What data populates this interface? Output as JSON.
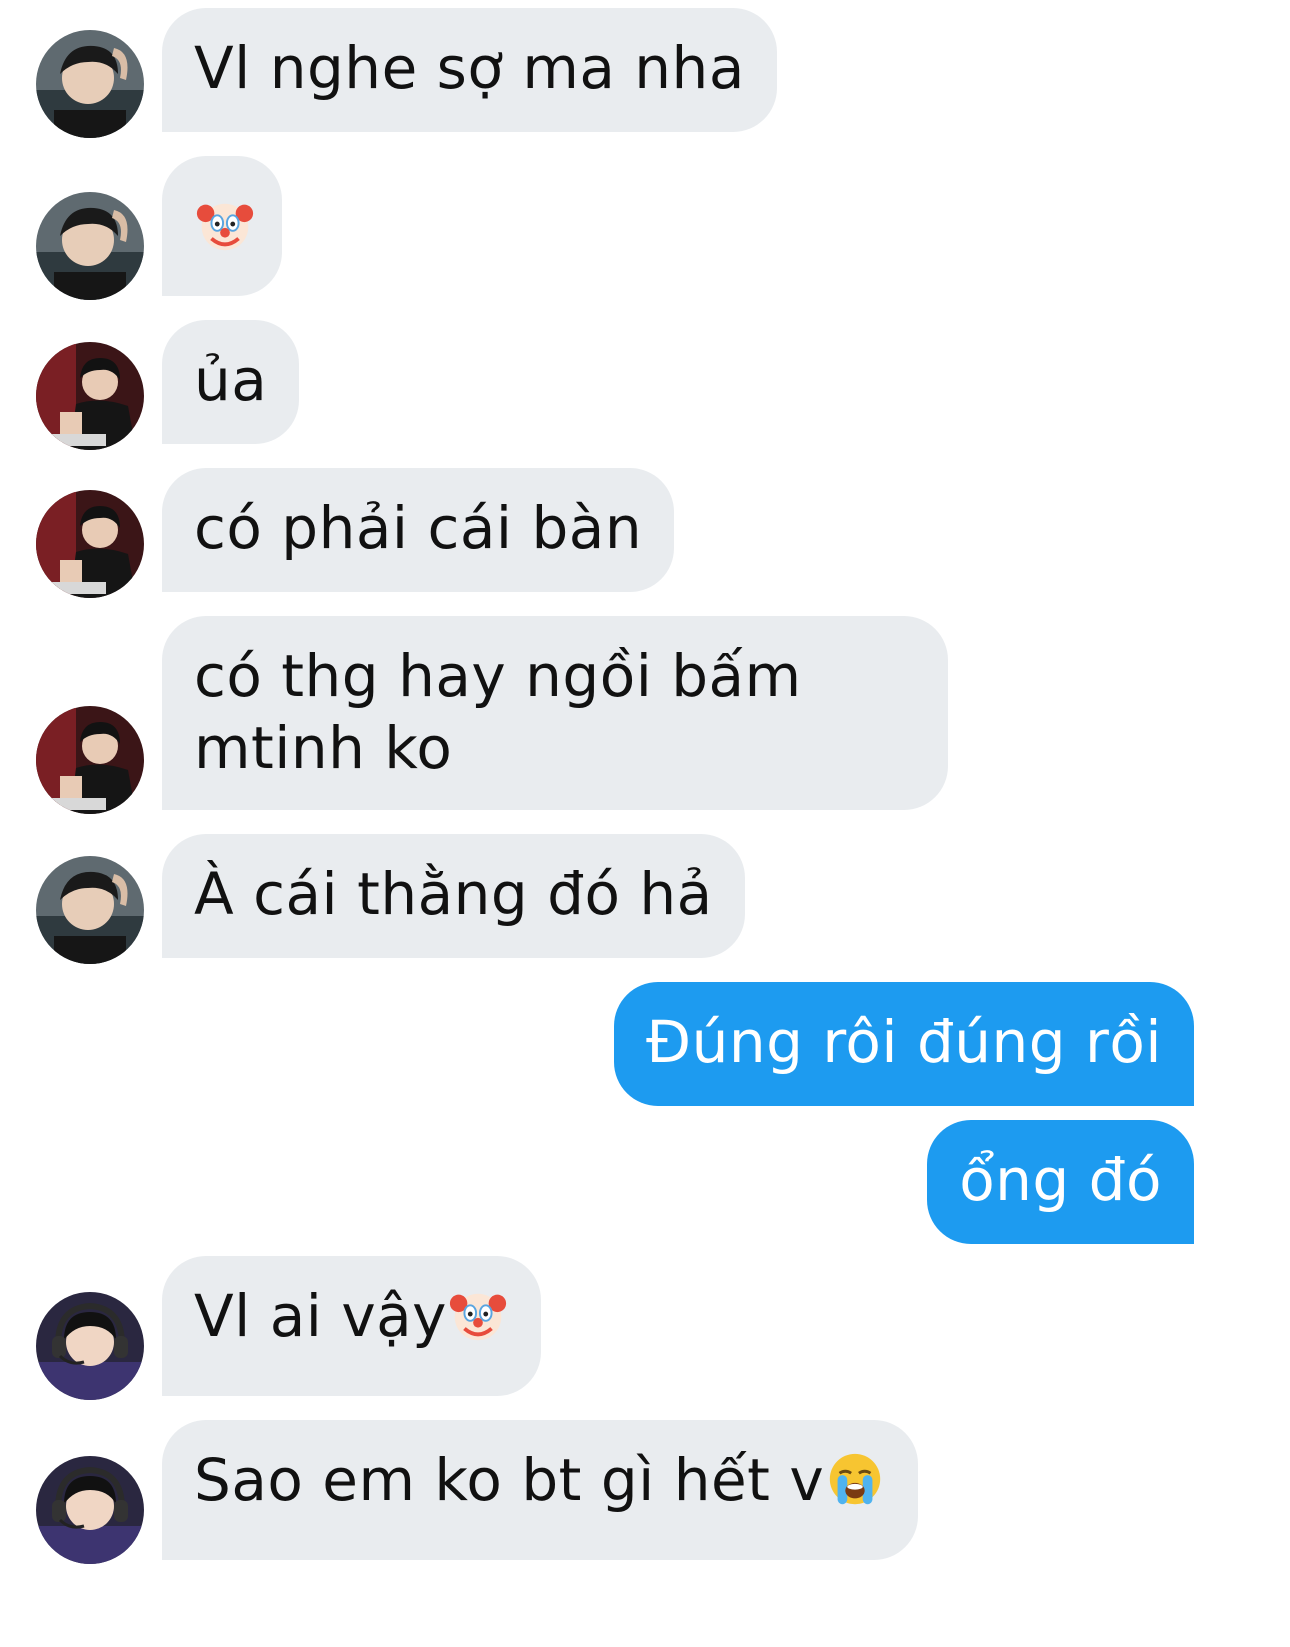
{
  "messages": [
    {
      "id": "m1",
      "direction": "in",
      "sender": "user-a",
      "text": "Vl nghe sợ ma nha"
    },
    {
      "id": "m2",
      "direction": "in",
      "sender": "user-a",
      "text": "",
      "emoji": "clown-face"
    },
    {
      "id": "m3",
      "direction": "in",
      "sender": "user-b",
      "text": "ủa"
    },
    {
      "id": "m4",
      "direction": "in",
      "sender": "user-b",
      "text": "có phải cái bàn"
    },
    {
      "id": "m5",
      "direction": "in",
      "sender": "user-b",
      "text": "có thg hay ngồi bấm mtinh ko"
    },
    {
      "id": "m6",
      "direction": "in",
      "sender": "user-a",
      "text": "À cái thằng đó hả"
    },
    {
      "id": "m7",
      "direction": "out",
      "sender": "me",
      "text": "Đúng rôi đúng rồi"
    },
    {
      "id": "m8",
      "direction": "out",
      "sender": "me",
      "text": "ổng đó"
    },
    {
      "id": "m9",
      "direction": "in",
      "sender": "user-c",
      "text": "Vl ai vậy",
      "emoji": "clown-face"
    },
    {
      "id": "m10",
      "direction": "in",
      "sender": "user-c",
      "text": "Sao em ko bt gì hết v",
      "emoji": "loudly-crying-face"
    }
  ],
  "colors": {
    "incoming_bubble": "#e9ecef",
    "outgoing_bubble": "#1d9bf0",
    "incoming_text": "#111111",
    "outgoing_text": "#ffffff"
  }
}
